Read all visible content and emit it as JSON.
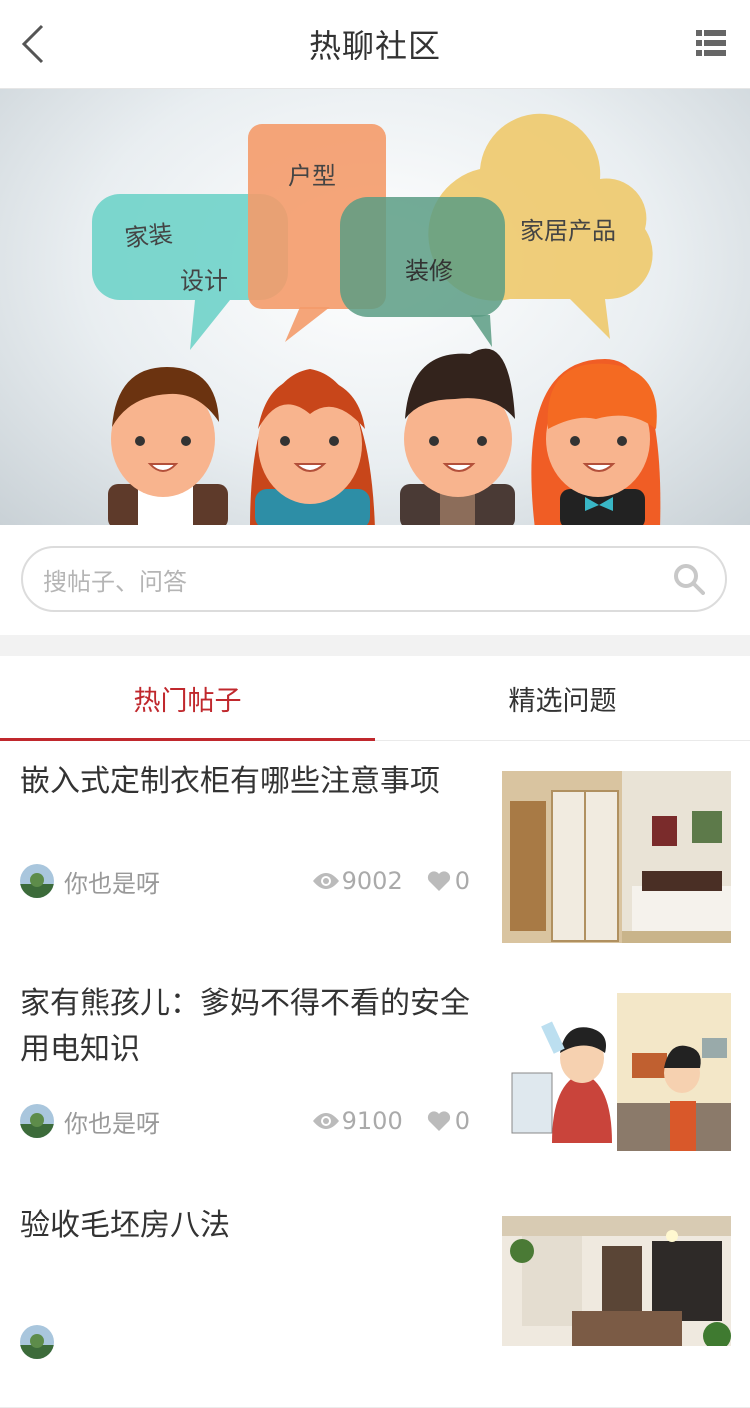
{
  "header": {
    "title": "热聊社区"
  },
  "banner": {
    "bubbles": [
      "家装",
      "设计",
      "户型",
      "装修",
      "家居产品"
    ]
  },
  "search": {
    "placeholder": "搜帖子、问答"
  },
  "tabs": [
    {
      "label": "热门帖子",
      "active": true
    },
    {
      "label": "精选问题",
      "active": false
    }
  ],
  "posts": [
    {
      "title": "嵌入式定制衣柜有哪些注意事项",
      "author": "你也是呀",
      "views": "9002",
      "likes": "0"
    },
    {
      "title": "家有熊孩儿：爹妈不得不看的安全用电知识",
      "author": "你也是呀",
      "views": "9100",
      "likes": "0"
    },
    {
      "title": "验收毛坯房八法",
      "author": "",
      "views": "",
      "likes": ""
    }
  ],
  "colors": {
    "accent": "#c0282d",
    "text": "#333333",
    "muted": "#999999"
  }
}
